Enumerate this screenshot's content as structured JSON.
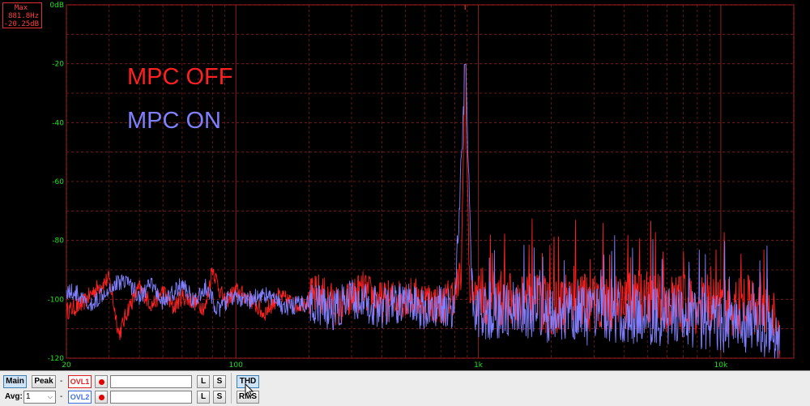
{
  "chart_data": {
    "type": "line",
    "xscale": "log",
    "xlim": [
      20,
      20000
    ],
    "ylim": [
      -120,
      0
    ],
    "grid": true,
    "x_ticks": [
      "20",
      "100",
      "1k",
      "10k"
    ],
    "y_ticks": [
      "0dB",
      "-20",
      "-40",
      "-60",
      "-80",
      "-100",
      "-120"
    ],
    "peak_marker_freq": 881.8,
    "series": [
      {
        "name": "MPC OFF",
        "color": "#ff2020",
        "points": [
          [
            20,
            -104
          ],
          [
            23,
            -102
          ],
          [
            26,
            -97
          ],
          [
            30,
            -93
          ],
          [
            33,
            -112
          ],
          [
            36,
            -103
          ],
          [
            40,
            -96
          ],
          [
            45,
            -102
          ],
          [
            50,
            -97
          ],
          [
            55,
            -103
          ],
          [
            60,
            -99
          ],
          [
            68,
            -101
          ],
          [
            75,
            -103
          ],
          [
            80,
            -89
          ],
          [
            85,
            -96
          ],
          [
            90,
            -101
          ],
          [
            100,
            -97
          ],
          [
            115,
            -100
          ],
          [
            130,
            -105
          ],
          [
            150,
            -99
          ],
          [
            180,
            -102
          ],
          [
            220,
            -98
          ],
          [
            270,
            -103
          ],
          [
            330,
            -97
          ],
          [
            400,
            -101
          ],
          [
            500,
            -99
          ],
          [
            600,
            -100
          ],
          [
            700,
            -102
          ],
          [
            800,
            -98
          ],
          [
            850,
            -92
          ],
          [
            881.8,
            -20.25
          ],
          [
            920,
            -97
          ],
          [
            1000,
            -99
          ],
          [
            1200,
            -100
          ],
          [
            1500,
            -101
          ],
          [
            2000,
            -102
          ],
          [
            3000,
            -101
          ],
          [
            4000,
            -100
          ],
          [
            6000,
            -101
          ],
          [
            8000,
            -102
          ],
          [
            10000,
            -103
          ],
          [
            13000,
            -102
          ],
          [
            16000,
            -103
          ],
          [
            17500,
            -116
          ]
        ]
      },
      {
        "name": "MPC ON",
        "color": "#8080ff",
        "points": [
          [
            20,
            -97
          ],
          [
            22,
            -98
          ],
          [
            25,
            -103
          ],
          [
            28,
            -98
          ],
          [
            30,
            -96
          ],
          [
            35,
            -93
          ],
          [
            40,
            -99
          ],
          [
            45,
            -95
          ],
          [
            50,
            -101
          ],
          [
            55,
            -98
          ],
          [
            60,
            -95
          ],
          [
            68,
            -101
          ],
          [
            75,
            -96
          ],
          [
            85,
            -104
          ],
          [
            95,
            -99
          ],
          [
            110,
            -101
          ],
          [
            130,
            -98
          ],
          [
            160,
            -103
          ],
          [
            200,
            -101
          ],
          [
            250,
            -104
          ],
          [
            300,
            -100
          ],
          [
            400,
            -103
          ],
          [
            500,
            -101
          ],
          [
            600,
            -104
          ],
          [
            700,
            -102
          ],
          [
            800,
            -103
          ],
          [
            881.8,
            -20.25
          ],
          [
            950,
            -103
          ],
          [
            1000,
            -104
          ],
          [
            1300,
            -103
          ],
          [
            1600,
            -104
          ],
          [
            2000,
            -105
          ],
          [
            3000,
            -106
          ],
          [
            4000,
            -105
          ],
          [
            6000,
            -106
          ],
          [
            8000,
            -107
          ],
          [
            10000,
            -108
          ],
          [
            13000,
            -109
          ],
          [
            16000,
            -110
          ],
          [
            17500,
            -118
          ]
        ]
      }
    ]
  },
  "peak_readout": {
    "label": "Max",
    "freq": "881.8Hz",
    "level": "-20.25dB"
  },
  "legend": {
    "off_label": "MPC OFF",
    "on_label": "MPC ON",
    "off_color": "#ff2020",
    "on_color": "#8080ff"
  },
  "toolbar": {
    "main_label": "Main",
    "peak_label": "Peak",
    "avg_label": "Avg:",
    "avg_value": "1",
    "ovl1_label": "OVL1",
    "ovl2_label": "OVL2",
    "ovl1_color": "#e02020",
    "ovl2_color": "#4070e0",
    "dash": "-",
    "l_label": "L",
    "s_label": "S",
    "thd_label": "THD",
    "rms_label": "RMS"
  },
  "colors": {
    "grid": "#8a2020",
    "axis_label": "#20e020",
    "frame": "#c02020"
  }
}
